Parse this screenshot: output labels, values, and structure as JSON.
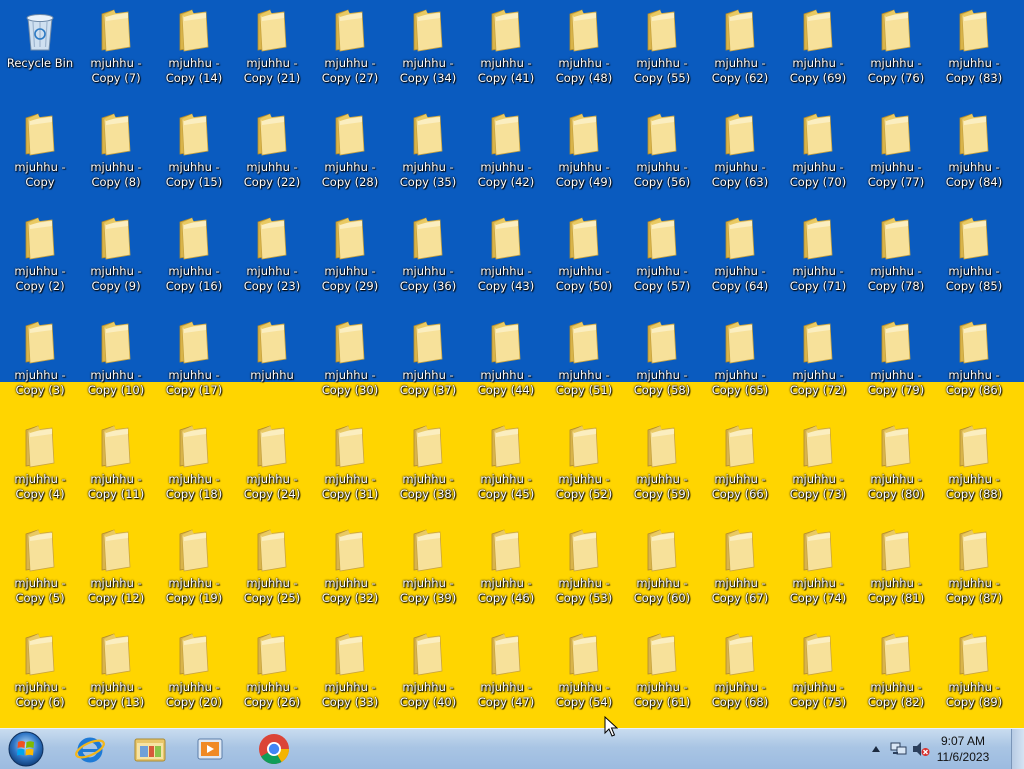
{
  "desktop": {
    "recycle_bin": {
      "label": "Recycle Bin",
      "icon": "recycle-bin-icon"
    },
    "folders": [
      [
        "mjuhhu - Copy (7)",
        "mjuhhu - Copy (14)",
        "mjuhhu - Copy (21)",
        "mjuhhu - Copy (27)",
        "mjuhhu - Copy (34)",
        "mjuhhu - Copy (41)",
        "mjuhhu - Copy (48)",
        "mjuhhu - Copy (55)",
        "mjuhhu - Copy (62)",
        "mjuhhu - Copy (69)",
        "mjuhhu - Copy (76)",
        "mjuhhu - Copy (83)"
      ],
      [
        "mjuhhu - Copy",
        "mjuhhu - Copy (8)",
        "mjuhhu - Copy (15)",
        "mjuhhu - Copy (22)",
        "mjuhhu - Copy (28)",
        "mjuhhu - Copy (35)",
        "mjuhhu - Copy (42)",
        "mjuhhu - Copy (49)",
        "mjuhhu - Copy (56)",
        "mjuhhu - Copy (63)",
        "mjuhhu - Copy (70)",
        "mjuhhu - Copy (77)",
        "mjuhhu - Copy (84)"
      ],
      [
        "mjuhhu - Copy (2)",
        "mjuhhu - Copy (9)",
        "mjuhhu - Copy (16)",
        "mjuhhu - Copy (23)",
        "mjuhhu - Copy (29)",
        "mjuhhu - Copy (36)",
        "mjuhhu - Copy (43)",
        "mjuhhu - Copy (50)",
        "mjuhhu - Copy (57)",
        "mjuhhu - Copy (64)",
        "mjuhhu - Copy (71)",
        "mjuhhu - Copy (78)",
        "mjuhhu - Copy (85)"
      ],
      [
        "mjuhhu - Copy (3)",
        "mjuhhu - Copy (10)",
        "mjuhhu - Copy (17)",
        "mjuhhu",
        "mjuhhu - Copy (30)",
        "mjuhhu - Copy (37)",
        "mjuhhu - Copy (44)",
        "mjuhhu - Copy (51)",
        "mjuhhu - Copy (58)",
        "mjuhhu - Copy (65)",
        "mjuhhu - Copy (72)",
        "mjuhhu - Copy (79)",
        "mjuhhu - Copy (86)"
      ],
      [
        "mjuhhu - Copy (4)",
        "mjuhhu - Copy (11)",
        "mjuhhu - Copy (18)",
        "mjuhhu - Copy (24)",
        "mjuhhu - Copy (31)",
        "mjuhhu - Copy (38)",
        "mjuhhu - Copy (45)",
        "mjuhhu - Copy (52)",
        "mjuhhu - Copy (59)",
        "mjuhhu - Copy (66)",
        "mjuhhu - Copy (73)",
        "mjuhhu - Copy (80)",
        "mjuhhu - Copy (88)"
      ],
      [
        "mjuhhu - Copy (5)",
        "mjuhhu - Copy (12)",
        "mjuhhu - Copy (19)",
        "mjuhhu - Copy (25)",
        "mjuhhu - Copy (32)",
        "mjuhhu - Copy (39)",
        "mjuhhu - Copy (46)",
        "mjuhhu - Copy (53)",
        "mjuhhu - Copy (60)",
        "mjuhhu - Copy (67)",
        "mjuhhu - Copy (74)",
        "mjuhhu - Copy (81)",
        "mjuhhu - Copy (87)"
      ],
      [
        "mjuhhu - Copy (6)",
        "mjuhhu - Copy (13)",
        "mjuhhu - Copy (20)",
        "mjuhhu - Copy (26)",
        "mjuhhu - Copy (33)",
        "mjuhhu - Copy (40)",
        "mjuhhu - Copy (47)",
        "mjuhhu - Copy (54)",
        "mjuhhu - Copy (61)",
        "mjuhhu - Copy (68)",
        "mjuhhu - Copy (75)",
        "mjuhhu - Copy (82)",
        "mjuhhu - Copy (89)"
      ]
    ],
    "wallpaper_colors": {
      "top": "#0a5bbf",
      "bottom": "#ffd500"
    }
  },
  "taskbar": {
    "start_icon": "windows-logo-icon",
    "pinned": [
      {
        "name": "internet-explorer",
        "icon": "internet-explorer-icon"
      },
      {
        "name": "windows-explorer",
        "icon": "folder-library-icon"
      },
      {
        "name": "media-player",
        "icon": "media-player-icon"
      },
      {
        "name": "google-chrome",
        "icon": "chrome-icon"
      }
    ],
    "tray": {
      "time": "9:07 AM",
      "date": "11/6/2023",
      "icons": [
        "show-hidden-icons-arrow",
        "network-icon",
        "volume-muted-icon"
      ]
    }
  }
}
